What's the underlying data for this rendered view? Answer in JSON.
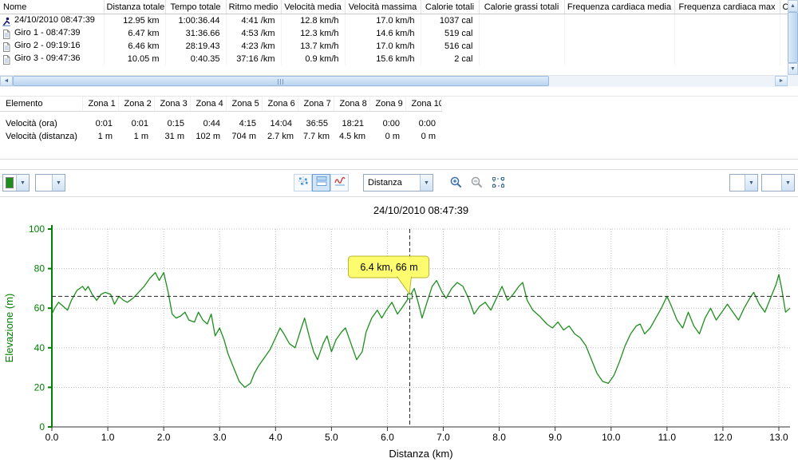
{
  "glyphs": {
    "dropdown": "▼",
    "scroll_up": "▲",
    "scroll_down": "▼",
    "scroll_left": "◄",
    "scroll_right": "►"
  },
  "activity_table": {
    "columns": [
      "Nome",
      "Distanza totale",
      "Tempo totale",
      "Ritmo medio",
      "Velocità media",
      "Velocità massima",
      "Calorie totali",
      "Calorie grassi totali",
      "Frequenza cardiaca media",
      "Frequenza cardiaca max",
      "C..."
    ],
    "rows": [
      {
        "icon": "activity-icon",
        "cells": [
          "24/10/2010 08:47:39",
          "12.95 km",
          "1:00:36.44",
          "4:41 /km",
          "12.8 km/h",
          "17.0 km/h",
          "1037 cal",
          "",
          "",
          "",
          ""
        ]
      },
      {
        "icon": "lap-icon",
        "cells": [
          "Giro 1 - 08:47:39",
          "6.47 km",
          "31:36.66",
          "4:53 /km",
          "12.3 km/h",
          "14.6 km/h",
          "519 cal",
          "",
          "",
          "",
          ""
        ]
      },
      {
        "icon": "lap-icon",
        "cells": [
          "Giro 2 - 09:19:16",
          "6.46 km",
          "28:19.43",
          "4:23 /km",
          "13.7 km/h",
          "17.0 km/h",
          "516 cal",
          "",
          "",
          "",
          ""
        ]
      },
      {
        "icon": "lap-icon",
        "cells": [
          "Giro 3 - 09:47:36",
          "10.05 m",
          "0:40.35",
          "37:16 /km",
          "0.9 km/h",
          "15.6 km/h",
          "2 cal",
          "",
          "",
          "",
          ""
        ]
      }
    ]
  },
  "zone_table": {
    "element_header": "Elemento",
    "zone_headers": [
      "Zona 1",
      "Zona 2",
      "Zona 3",
      "Zona 4",
      "Zona 5",
      "Zona 6",
      "Zona 7",
      "Zona 8",
      "Zona 9",
      "Zona 10"
    ],
    "rows": [
      {
        "label": "Velocità (ora)",
        "values": [
          "0:01",
          "0:01",
          "0:15",
          "0:44",
          "4:15",
          "14:04",
          "36:55",
          "18:21",
          "0:00",
          "0:00"
        ]
      },
      {
        "label": "Velocità (distanza)",
        "values": [
          "1 m",
          "1 m",
          "31 m",
          "102 m",
          "704 m",
          "2.7 km",
          "7.7 km",
          "4.5 km",
          "0 m",
          "0 m"
        ]
      }
    ]
  },
  "toolbar": {
    "series_color": "#1e8f1e",
    "x_axis_select": "Distanza"
  },
  "chart_data": {
    "type": "line",
    "title": "24/10/2010 08:47:39",
    "xlabel": "Distanza (km)",
    "ylabel": "Elevazione (m)",
    "xlim": [
      0,
      13.2
    ],
    "ylim": [
      0,
      100
    ],
    "x_ticks": [
      0,
      1,
      2,
      3,
      4,
      5,
      6,
      7,
      8,
      9,
      10,
      11,
      12,
      13
    ],
    "y_ticks": [
      0,
      20,
      40,
      60,
      80,
      100
    ],
    "grid": true,
    "legend_position": "none",
    "line_color": "#1e8f1e",
    "axis_color": "#008000",
    "cursor": {
      "x": 6.4,
      "y": 66,
      "label": "6.4 km, 66 m"
    },
    "points": [
      [
        0,
        57
      ],
      [
        0.05,
        60
      ],
      [
        0.12,
        63
      ],
      [
        0.2,
        61
      ],
      [
        0.28,
        59
      ],
      [
        0.35,
        64
      ],
      [
        0.45,
        69
      ],
      [
        0.55,
        71
      ],
      [
        0.6,
        69
      ],
      [
        0.65,
        71
      ],
      [
        0.72,
        67
      ],
      [
        0.8,
        64
      ],
      [
        0.88,
        67
      ],
      [
        0.95,
        68
      ],
      [
        1.05,
        67
      ],
      [
        1.12,
        62
      ],
      [
        1.2,
        66
      ],
      [
        1.28,
        64
      ],
      [
        1.35,
        63
      ],
      [
        1.45,
        65
      ],
      [
        1.55,
        68
      ],
      [
        1.65,
        71
      ],
      [
        1.75,
        75
      ],
      [
        1.85,
        78
      ],
      [
        1.92,
        74
      ],
      [
        2.0,
        78
      ],
      [
        2.08,
        68
      ],
      [
        2.15,
        57
      ],
      [
        2.22,
        55
      ],
      [
        2.3,
        56
      ],
      [
        2.38,
        58
      ],
      [
        2.45,
        54
      ],
      [
        2.55,
        53
      ],
      [
        2.62,
        58
      ],
      [
        2.7,
        54
      ],
      [
        2.78,
        52
      ],
      [
        2.85,
        57
      ],
      [
        2.92,
        46
      ],
      [
        3.0,
        50
      ],
      [
        3.08,
        44
      ],
      [
        3.15,
        37
      ],
      [
        3.25,
        30
      ],
      [
        3.35,
        23
      ],
      [
        3.45,
        20
      ],
      [
        3.55,
        22
      ],
      [
        3.62,
        27
      ],
      [
        3.7,
        31
      ],
      [
        3.8,
        35
      ],
      [
        3.9,
        39
      ],
      [
        4.0,
        45
      ],
      [
        4.08,
        50
      ],
      [
        4.15,
        47
      ],
      [
        4.25,
        42
      ],
      [
        4.35,
        40
      ],
      [
        4.45,
        49
      ],
      [
        4.52,
        55
      ],
      [
        4.6,
        46
      ],
      [
        4.68,
        38
      ],
      [
        4.75,
        34
      ],
      [
        4.85,
        42
      ],
      [
        4.92,
        46
      ],
      [
        5.0,
        38
      ],
      [
        5.08,
        44
      ],
      [
        5.18,
        48
      ],
      [
        5.25,
        50
      ],
      [
        5.35,
        42
      ],
      [
        5.45,
        34
      ],
      [
        5.55,
        38
      ],
      [
        5.62,
        48
      ],
      [
        5.72,
        55
      ],
      [
        5.82,
        59
      ],
      [
        5.9,
        55
      ],
      [
        5.98,
        59
      ],
      [
        6.08,
        63
      ],
      [
        6.18,
        57
      ],
      [
        6.28,
        61
      ],
      [
        6.4,
        66
      ],
      [
        6.48,
        70
      ],
      [
        6.55,
        63
      ],
      [
        6.62,
        55
      ],
      [
        6.72,
        64
      ],
      [
        6.8,
        71
      ],
      [
        6.88,
        74
      ],
      [
        6.98,
        68
      ],
      [
        7.05,
        65
      ],
      [
        7.15,
        70
      ],
      [
        7.25,
        73
      ],
      [
        7.35,
        71
      ],
      [
        7.45,
        65
      ],
      [
        7.55,
        57
      ],
      [
        7.65,
        61
      ],
      [
        7.75,
        63
      ],
      [
        7.85,
        59
      ],
      [
        7.95,
        65
      ],
      [
        8.05,
        71
      ],
      [
        8.15,
        64
      ],
      [
        8.25,
        67
      ],
      [
        8.35,
        71
      ],
      [
        8.42,
        73
      ],
      [
        8.5,
        64
      ],
      [
        8.6,
        59
      ],
      [
        8.72,
        56
      ],
      [
        8.85,
        52
      ],
      [
        8.95,
        50
      ],
      [
        9.05,
        53
      ],
      [
        9.15,
        49
      ],
      [
        9.25,
        51
      ],
      [
        9.35,
        47
      ],
      [
        9.45,
        45
      ],
      [
        9.55,
        41
      ],
      [
        9.65,
        34
      ],
      [
        9.75,
        27
      ],
      [
        9.85,
        23
      ],
      [
        9.95,
        22
      ],
      [
        10.05,
        26
      ],
      [
        10.15,
        33
      ],
      [
        10.25,
        41
      ],
      [
        10.35,
        47
      ],
      [
        10.45,
        51
      ],
      [
        10.52,
        52
      ],
      [
        10.6,
        47
      ],
      [
        10.7,
        50
      ],
      [
        10.8,
        55
      ],
      [
        10.9,
        60
      ],
      [
        11.0,
        66
      ],
      [
        11.08,
        61
      ],
      [
        11.18,
        54
      ],
      [
        11.28,
        50
      ],
      [
        11.38,
        58
      ],
      [
        11.48,
        51
      ],
      [
        11.58,
        47
      ],
      [
        11.68,
        55
      ],
      [
        11.78,
        60
      ],
      [
        11.88,
        54
      ],
      [
        11.98,
        58
      ],
      [
        12.08,
        62
      ],
      [
        12.18,
        58
      ],
      [
        12.28,
        54
      ],
      [
        12.38,
        60
      ],
      [
        12.48,
        65
      ],
      [
        12.55,
        68
      ],
      [
        12.65,
        62
      ],
      [
        12.75,
        58
      ],
      [
        12.85,
        65
      ],
      [
        12.95,
        72
      ],
      [
        13.0,
        77
      ],
      [
        13.05,
        70
      ],
      [
        13.12,
        58
      ],
      [
        13.2,
        60
      ]
    ]
  }
}
